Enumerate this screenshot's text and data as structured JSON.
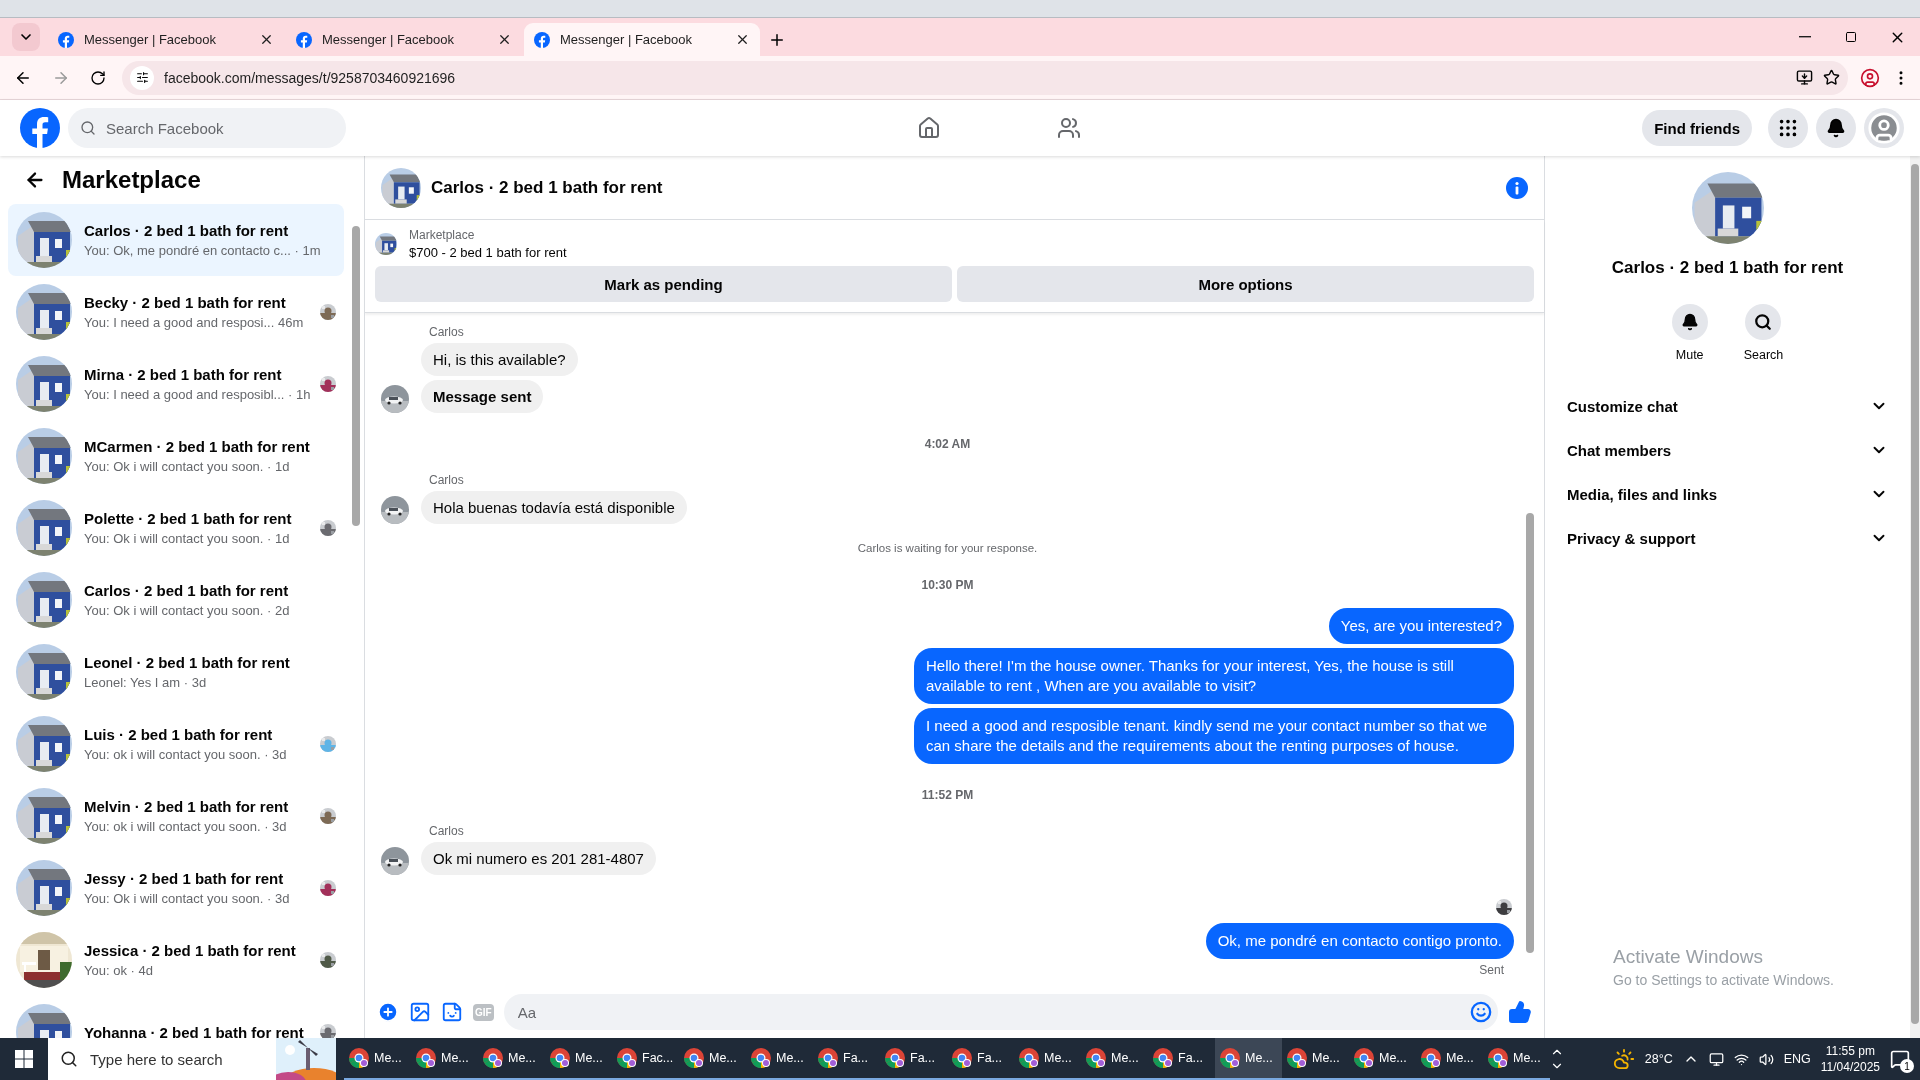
{
  "browser": {
    "tabs": [
      {
        "title": "Messenger | Facebook",
        "selected": false
      },
      {
        "title": "Messenger | Facebook",
        "selected": false
      },
      {
        "title": "Messenger | Facebook",
        "selected": true
      }
    ],
    "url": "facebook.com/messages/t/9258703460921696"
  },
  "header": {
    "search_placeholder": "Search Facebook",
    "find_friends": "Find friends"
  },
  "sidebar": {
    "title": "Marketplace",
    "conversations": [
      {
        "name": "Carlos · 2 bed 1 bath for rent",
        "preview": "You: Ok, me pondré en contacto c... · 1m",
        "selected": true,
        "seen": false
      },
      {
        "name": "Becky · 2 bed 1 bath for rent",
        "preview": "You: I need a good and resposi... 46m",
        "selected": false,
        "seen": true
      },
      {
        "name": "Mirna · 2 bed 1 bath for rent",
        "preview": "You: I need a good and resposibl... · 1h",
        "selected": false,
        "seen": true
      },
      {
        "name": "MCarmen · 2 bed 1 bath for rent",
        "preview": "You: Ok i will contact you soon. · 1d",
        "selected": false,
        "seen": false
      },
      {
        "name": "Polette · 2 bed 1 bath for rent",
        "preview": "You: Ok i will contact you soon. · 1d",
        "selected": false,
        "seen": true
      },
      {
        "name": "Carlos · 2 bed 1 bath for rent",
        "preview": "You: Ok i will contact you soon. · 2d",
        "selected": false,
        "seen": false
      },
      {
        "name": "Leonel · 2 bed 1 bath for rent",
        "preview": "Leonel: Yes I am · 3d",
        "selected": false,
        "seen": false
      },
      {
        "name": "Luis · 2 bed 1 bath for rent",
        "preview": "You: ok i will contact you soon. · 3d",
        "selected": false,
        "seen": true
      },
      {
        "name": "Melvin · 2 bed 1 bath for rent",
        "preview": "You: ok i will contact you soon. · 3d",
        "selected": false,
        "seen": true
      },
      {
        "name": "Jessy · 2 bed 1 bath for rent",
        "preview": "You: Ok i will contact you soon. · 3d",
        "selected": false,
        "seen": true
      },
      {
        "name": "Jessica · 2 bed 1 bath for rent",
        "preview": "You: ok · 4d",
        "selected": false,
        "seen": true
      },
      {
        "name": "Yohanna · 2 bed 1 bath for rent",
        "selected": false,
        "seen": true
      }
    ]
  },
  "chat": {
    "title": "Carlos · 2 bed 1 bath for rent",
    "listing": {
      "label": "Marketplace",
      "price": "$700 - 2 bed 1 bath for rent",
      "buttons": [
        "Mark as pending",
        "More options"
      ]
    },
    "messages": [
      {
        "kind": "sender",
        "text": "Carlos"
      },
      {
        "kind": "incoming",
        "text": "Hi, is this available?",
        "avatar": false,
        "bold": false
      },
      {
        "kind": "incoming",
        "text": "Message sent",
        "avatar": true,
        "bold": true
      },
      {
        "kind": "time",
        "text": "4:02 AM"
      },
      {
        "kind": "sender",
        "text": "Carlos"
      },
      {
        "kind": "incoming",
        "text": "Hola buenas todavía está disponible",
        "avatar": true,
        "bold": false
      },
      {
        "kind": "notice",
        "text": "Carlos is waiting for your response."
      },
      {
        "kind": "time",
        "text": "10:30 PM"
      },
      {
        "kind": "outgoing",
        "text": "Yes, are you interested?"
      },
      {
        "kind": "outgoing",
        "text": "Hello there! I'm the house owner. Thanks for your interest, Yes, the house is still available to rent , When are you available to visit?"
      },
      {
        "kind": "outgoing",
        "text": "I need a good and resposible tenant.  kindly send me your contact number so that we can share the details and the requirements about the renting purposes of house."
      },
      {
        "kind": "time",
        "text": "11:52 PM"
      },
      {
        "kind": "sender",
        "text": "Carlos"
      },
      {
        "kind": "incoming",
        "text": "Ok  mi numero es 201 281-4807",
        "avatar": true,
        "bold": false
      },
      {
        "kind": "seen"
      },
      {
        "kind": "outgoing",
        "text": "Ok, me pondré en contacto contigo pronto."
      },
      {
        "kind": "status",
        "text": "Sent"
      }
    ],
    "composer": {
      "gif": "GIF",
      "placeholder": "Aa"
    }
  },
  "details": {
    "title": "Carlos · 2 bed 1 bath for rent",
    "actions": [
      {
        "kind": "mute",
        "label": "Mute"
      },
      {
        "kind": "search",
        "label": "Search"
      }
    ],
    "sections": [
      {
        "label": "Customize chat",
        "expanded": false
      },
      {
        "label": "Chat members",
        "expanded": false
      },
      {
        "label": "Media, files and links",
        "expanded": false
      },
      {
        "label": "Privacy & support",
        "expanded": false
      }
    ]
  },
  "activation": {
    "title": "Activate Windows",
    "subtitle": "Go to Settings to activate Windows."
  },
  "taskbar": {
    "search_placeholder": "Type here to search",
    "apps": [
      {
        "label": "Me...",
        "selected": false
      },
      {
        "label": "Me...",
        "selected": false
      },
      {
        "label": "Me...",
        "selected": false
      },
      {
        "label": "Me...",
        "selected": false
      },
      {
        "label": "Fac...",
        "selected": false
      },
      {
        "label": "Me...",
        "selected": false
      },
      {
        "label": "Me...",
        "selected": false
      },
      {
        "label": "Fa...",
        "selected": false
      },
      {
        "label": "Fa...",
        "selected": false
      },
      {
        "label": "Fa...",
        "selected": false
      },
      {
        "label": "Me...",
        "selected": false
      },
      {
        "label": "Me...",
        "selected": false
      },
      {
        "label": "Fa...",
        "selected": false
      },
      {
        "label": "Me...",
        "selected": true
      },
      {
        "label": "Me...",
        "selected": false
      },
      {
        "label": "Me...",
        "selected": false
      },
      {
        "label": "Me...",
        "selected": false
      },
      {
        "label": "Me...",
        "selected": false
      }
    ],
    "temperature": "28°C",
    "language": "ENG",
    "time": "11:55 pm",
    "date": "11/04/2025",
    "notifications": "1"
  }
}
